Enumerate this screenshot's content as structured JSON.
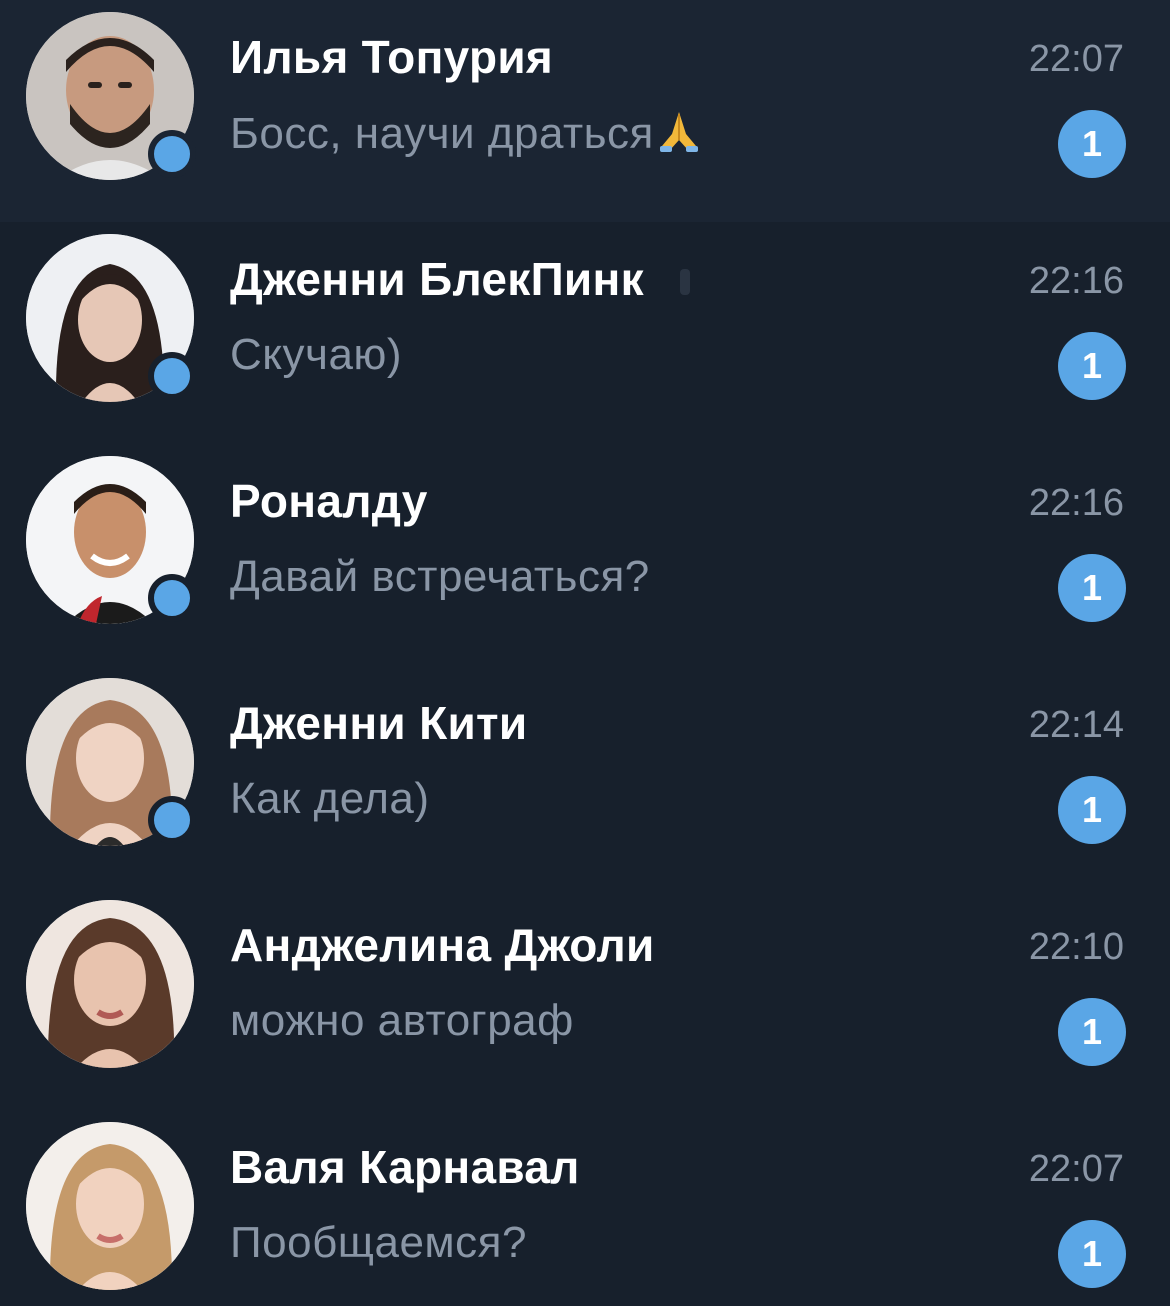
{
  "chats": [
    {
      "name": "Илья Топурия",
      "preview": "Босс, научи драться",
      "preview_emoji": "folded-hands-icon",
      "time": "22:07",
      "unread": "1",
      "online": true,
      "avatar": "avatar-photo-man-beard"
    },
    {
      "name": "Дженни БлекПинк",
      "preview": "Скучаю)",
      "time": "22:16",
      "unread": "1",
      "online": true,
      "avatar": "avatar-photo-woman-dark-hair"
    },
    {
      "name": "Роналду",
      "preview": "Давай встречаться?",
      "time": "22:16",
      "unread": "1",
      "online": true,
      "avatar": "avatar-photo-man-smiling"
    },
    {
      "name": "Дженни Кити",
      "preview": "Как дела)",
      "time": "22:14",
      "unread": "1",
      "online": true,
      "avatar": "avatar-photo-woman-light-hair"
    },
    {
      "name": "Анджелина Джоли",
      "preview": "можно автограф",
      "time": "22:10",
      "unread": "1",
      "online": false,
      "avatar": "avatar-photo-woman-brown-hair"
    },
    {
      "name": "Валя Карнавал",
      "preview": "Пообщаемся?",
      "time": "22:07",
      "unread": "1",
      "online": false,
      "avatar": "avatar-photo-woman-blonde"
    }
  ],
  "colors": {
    "background": "#17202c",
    "highlight_row": "#1b2533",
    "accent": "#5aa6e6",
    "secondary_text": "#8a96a6",
    "primary_text": "#ffffff"
  }
}
